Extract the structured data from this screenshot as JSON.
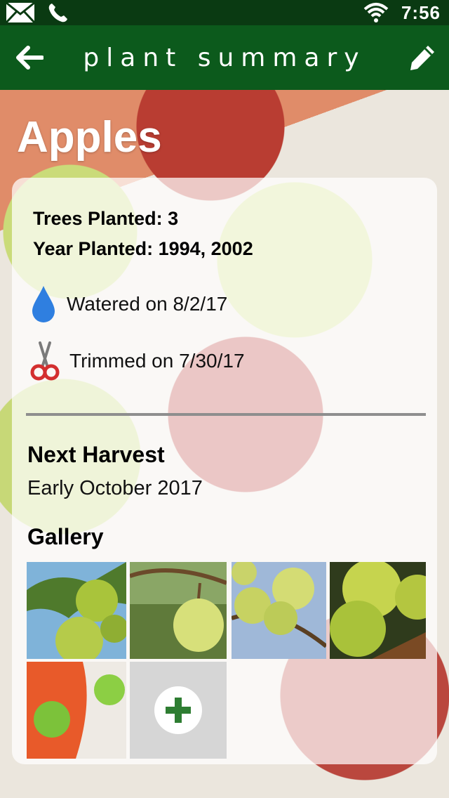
{
  "status_bar": {
    "time": "7:56",
    "icons": [
      "mail-icon",
      "phone-icon",
      "wifi-icon"
    ]
  },
  "app_bar": {
    "title": "plant summary",
    "back_icon": "arrow-left-icon",
    "edit_icon": "pencil-icon"
  },
  "plant": {
    "name": "Apples",
    "trees_planted": "Trees Planted: 3",
    "year_planted": "Year Planted: 1994, 2002"
  },
  "activities": [
    {
      "icon": "water-drop-icon",
      "text": "Watered on 8/2/17"
    },
    {
      "icon": "scissors-icon",
      "text": "Trimmed on 7/30/17"
    }
  ],
  "harvest": {
    "heading": "Next Harvest",
    "value": "Early October 2017"
  },
  "gallery": {
    "heading": "Gallery",
    "add_icon": "plus-icon"
  },
  "colors": {
    "status_bar": "#0a3a12",
    "app_bar": "#0c5a1c",
    "accent_green": "#2e7d32",
    "water_blue": "#2f7fe0",
    "scissors_red": "#d32f2f"
  }
}
